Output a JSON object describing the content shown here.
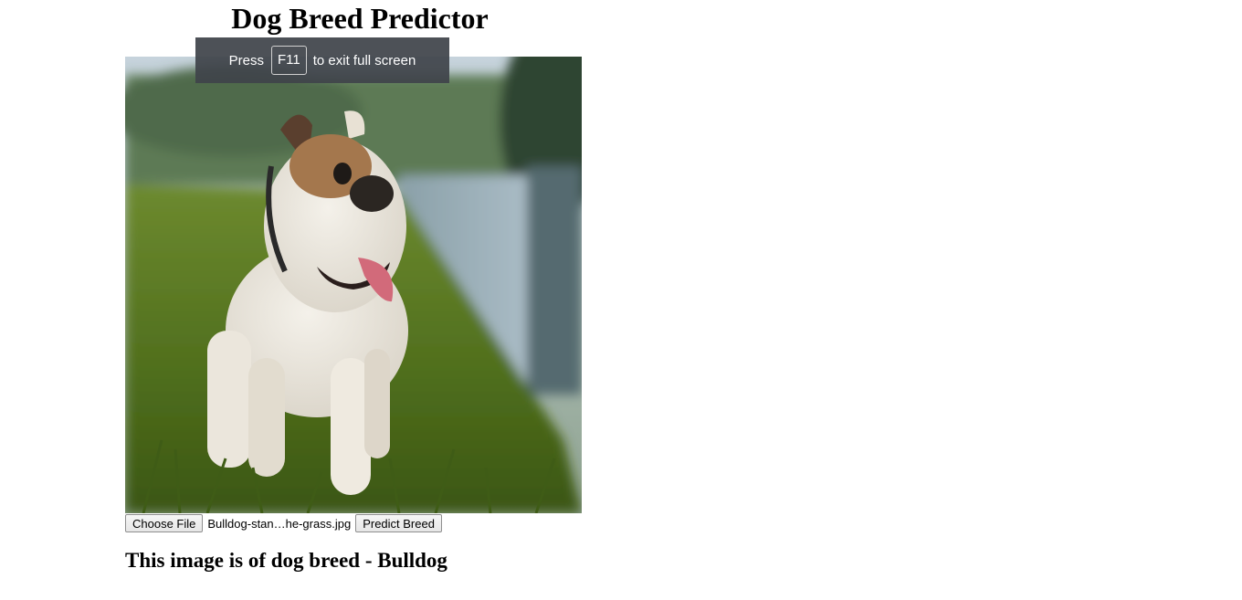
{
  "page": {
    "title": "Dog Breed Predictor",
    "image_alt": "Bulldog standing in the grass"
  },
  "fullscreen_toast": {
    "prefix": "Press",
    "key": "F11",
    "suffix": "to exit full screen"
  },
  "upload": {
    "choose_label": "Choose File",
    "file_name": "Bulldog-stan…he-grass.jpg",
    "predict_label": "Predict Breed"
  },
  "result": {
    "text": "This image is of dog breed - Bulldog"
  },
  "icons": {
    "photo": "dog-photo"
  }
}
